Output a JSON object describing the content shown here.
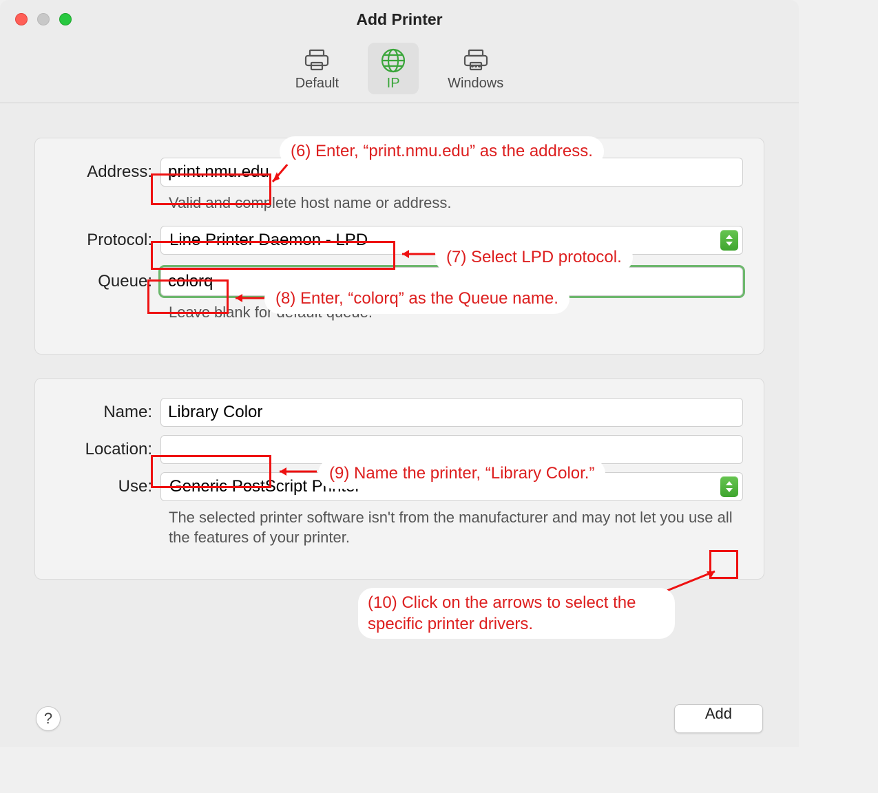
{
  "window": {
    "title": "Add Printer"
  },
  "toolbar": {
    "default_label": "Default",
    "ip_label": "IP",
    "windows_label": "Windows"
  },
  "labels": {
    "address": "Address:",
    "protocol": "Protocol:",
    "queue": "Queue:",
    "name": "Name:",
    "location": "Location:",
    "use": "Use:"
  },
  "fields": {
    "address_value": "print.nmu.edu",
    "address_hint": "Valid and complete host name or address.",
    "protocol_value": "Line Printer Daemon - LPD",
    "queue_value": "colorq",
    "queue_hint": "Leave blank for default queue.",
    "name_value": "Library Color",
    "location_value": "",
    "use_value": "Generic PostScript Printer",
    "use_hint": "The selected printer software isn't from the manufacturer and may not let you use all the features of your printer."
  },
  "footer": {
    "help": "?",
    "add": "Add"
  },
  "annotations": {
    "a6": "(6) Enter, “print.nmu.edu” as the address.",
    "a7": "(7) Select LPD protocol.",
    "a8": "(8) Enter, “colorq” as the Queue name.",
    "a9": "(9) Name the printer, “Library Color.”",
    "a10": "(10) Click on the arrows to select the specific printer drivers."
  }
}
